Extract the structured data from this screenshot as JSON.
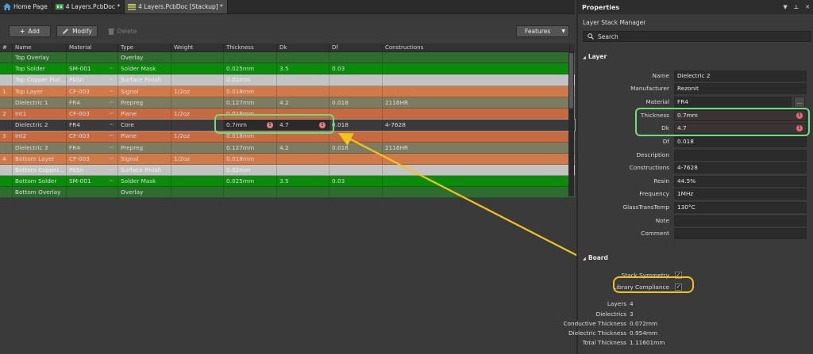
{
  "tabs": [
    {
      "label": "Home Page",
      "icon": "home-icon",
      "active": false
    },
    {
      "label": "4 Layers.PcbDoc",
      "icon": "pcb-icon",
      "active": false,
      "modified": true
    },
    {
      "label": "4 Layers.PcbDoc [Stackup]",
      "icon": "stackup-icon",
      "active": true,
      "modified": true
    }
  ],
  "toolbar": {
    "add_label": "Add",
    "modify_label": "Modify",
    "delete_label": "Delete",
    "features_label": "Features"
  },
  "table": {
    "columns": [
      "#",
      "Name",
      "Material",
      "Type",
      "Weight",
      "Thickness",
      "Dk",
      "Df",
      "Constructions"
    ],
    "rows": [
      {
        "num": "",
        "name": "Top Overlay",
        "material": "",
        "type": "Overlay",
        "weight": "",
        "thickness": "",
        "dk": "",
        "df": "",
        "constructions": "",
        "kind": "overlay"
      },
      {
        "num": "",
        "name": "Top Solder",
        "material": "SM-001",
        "type": "Solder Mask",
        "weight": "",
        "thickness": "0.025mm",
        "dk": "3.5",
        "df": "0.03",
        "constructions": "",
        "kind": "mask"
      },
      {
        "num": "",
        "name": "Top Copper Plat...",
        "material": "PbSn",
        "type": "Surface Finish",
        "weight": "",
        "thickness": "0.02mm",
        "dk": "",
        "df": "",
        "constructions": "",
        "kind": "finish"
      },
      {
        "num": "1",
        "name": "Top Layer",
        "material": "CF-003",
        "type": "Signal",
        "weight": "1/2oz",
        "thickness": "0.018mm",
        "dk": "",
        "df": "",
        "constructions": "",
        "kind": "signal"
      },
      {
        "num": "",
        "name": "Dielectric 1",
        "material": "FR4",
        "type": "Prepreg",
        "weight": "",
        "thickness": "0.127mm",
        "dk": "4.2",
        "df": "0.018",
        "constructions": "2116HR",
        "kind": "prepreg"
      },
      {
        "num": "2",
        "name": "Int1",
        "material": "CF-003",
        "type": "Plane",
        "weight": "1/2oz",
        "thickness": "0.018mm",
        "dk": "",
        "df": "",
        "constructions": "",
        "kind": "plane"
      },
      {
        "num": "",
        "name": "Dielectric 2",
        "material": "FR4",
        "type": "Core",
        "weight": "",
        "thickness": "0.7mm",
        "dk": "4.7",
        "df": "0.018",
        "constructions": "4-7628",
        "kind": "core"
      },
      {
        "num": "3",
        "name": "Int2",
        "material": "CF-003",
        "type": "Plane",
        "weight": "1/2oz",
        "thickness": "0.018mm",
        "dk": "",
        "df": "",
        "constructions": "",
        "kind": "plane"
      },
      {
        "num": "",
        "name": "Dielectric 3",
        "material": "FR4",
        "type": "Prepreg",
        "weight": "",
        "thickness": "0.127mm",
        "dk": "4.2",
        "df": "0.018",
        "constructions": "2116HR",
        "kind": "prepreg"
      },
      {
        "num": "4",
        "name": "Bottom Layer",
        "material": "CF-003",
        "type": "Signal",
        "weight": "1/2oz",
        "thickness": "0.018mm",
        "dk": "",
        "df": "",
        "constructions": "",
        "kind": "signal"
      },
      {
        "num": "",
        "name": "Bottom Copper...",
        "material": "PbSn",
        "type": "Surface Finish",
        "weight": "",
        "thickness": "0.02mm",
        "dk": "",
        "df": "",
        "constructions": "",
        "kind": "finish"
      },
      {
        "num": "",
        "name": "Bottom Solder",
        "material": "SM-001",
        "type": "Solder Mask",
        "weight": "",
        "thickness": "0.025mm",
        "dk": "3.5",
        "df": "0.03",
        "constructions": "",
        "kind": "mask"
      },
      {
        "num": "",
        "name": "Bottom Overlay",
        "material": "",
        "type": "Overlay",
        "weight": "",
        "thickness": "",
        "dk": "",
        "df": "",
        "constructions": "",
        "kind": "overlay"
      }
    ]
  },
  "properties": {
    "title": "Properties",
    "subtitle": "Layer Stack Manager",
    "search_placeholder": "Search",
    "layer_section": "Layer",
    "board_section": "Board",
    "layer_fields": [
      {
        "label": "Name",
        "value": "Dielectric 2"
      },
      {
        "label": "Manufacturer",
        "value": "Rezonit"
      },
      {
        "label": "Material",
        "value": "FR4"
      },
      {
        "label": "Thickness",
        "value": "0.7mm"
      },
      {
        "label": "Dk",
        "value": "4.7"
      },
      {
        "label": "Df",
        "value": "0.018"
      },
      {
        "label": "Description",
        "value": ""
      },
      {
        "label": "Constructions",
        "value": "4-7628"
      },
      {
        "label": "Resin",
        "value": "44.5%"
      },
      {
        "label": "Frequency",
        "value": "1MHz"
      },
      {
        "label": "GlassTransTemp",
        "value": "130°C"
      },
      {
        "label": "Note",
        "value": ""
      },
      {
        "label": "Comment",
        "value": ""
      }
    ],
    "board_checks": [
      {
        "label": "Stack Symmetry",
        "checked": true
      },
      {
        "label": "Library Compliance",
        "checked": true
      }
    ],
    "board_stats": [
      {
        "label": "Layers",
        "value": "4"
      },
      {
        "label": "Dielectrics",
        "value": "3"
      },
      {
        "label": "Conductive Thickness",
        "value": "0.072mm"
      },
      {
        "label": "Dielectric Thickness",
        "value": "0.954mm"
      },
      {
        "label": "Total Thickness",
        "value": "1.11601mm"
      }
    ]
  },
  "colors": {
    "overlay": "#2f6c2f",
    "solder_mask": "#0a8b0a",
    "surface_finish": "#c3c3c3",
    "signal": "#d07a4a",
    "prepreg": "#7c7c62",
    "plane": "#c76a3f",
    "highlight_green": "#6be07a",
    "arrow_yellow": "#f0c419"
  }
}
